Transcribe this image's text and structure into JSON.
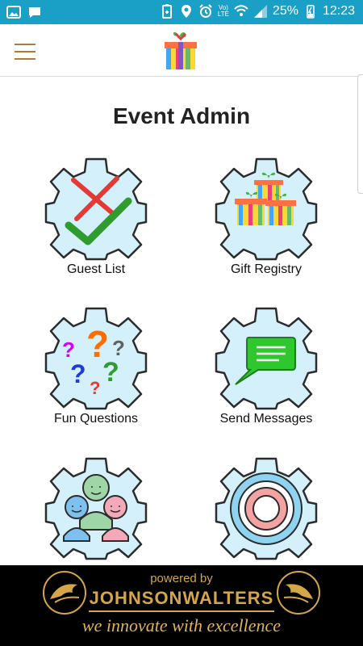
{
  "status_bar": {
    "battery": "25%",
    "time": "12:23",
    "network": "LTE"
  },
  "header": {
    "menu_icon": "hamburger-menu-icon",
    "logo_icon": "gift-box-icon"
  },
  "page": {
    "title": "Event Admin"
  },
  "tiles": [
    {
      "label": "Guest List",
      "icon": "check-cross-icon"
    },
    {
      "label": "Gift Registry",
      "icon": "gift-boxes-icon"
    },
    {
      "label": "Fun Questions",
      "icon": "question-marks-icon"
    },
    {
      "label": "Send Messages",
      "icon": "chat-bubble-icon"
    },
    {
      "label": "",
      "icon": "people-group-icon"
    },
    {
      "label": "",
      "icon": "target-ring-icon"
    }
  ],
  "footer": {
    "powered_by": "powered by",
    "brand": "JOHNSONWALTERS",
    "tagline": "we innovate with excellence"
  },
  "colors": {
    "status_bar": "#1a9fc6",
    "gear_fill": "#d4f1fb",
    "gear_stroke": "#2c2c2c",
    "brand_gold": "#d4a64a",
    "menu_icon": "#b07a3a"
  }
}
